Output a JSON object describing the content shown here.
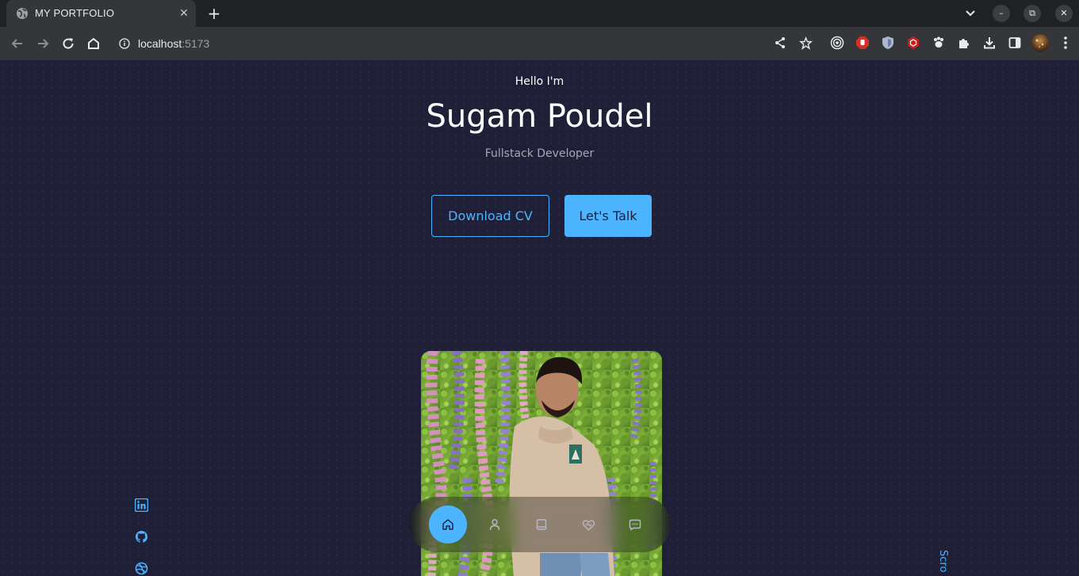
{
  "browser": {
    "tab_title": "MY PORTFOLIO",
    "tab_close": "✕",
    "new_tab": "+",
    "url_host": "localhost",
    "url_port": ":5173",
    "window_controls": {
      "minimize": "–",
      "restore": "⧉",
      "close": "✕"
    }
  },
  "header": {
    "greeting": "Hello I'm",
    "name": "Sugam Poudel",
    "role": "Fullstack Developer",
    "download_cv": "Download CV",
    "lets_talk": "Let's Talk"
  },
  "socials": [
    "linkedin-icon",
    "github-icon",
    "dribbble-icon"
  ],
  "scroll_label": "Scro",
  "nav": {
    "items": [
      "home-icon",
      "user-icon",
      "book-icon",
      "services-icon",
      "message-icon"
    ],
    "active_index": 0
  },
  "colors": {
    "accent": "#4db5ff",
    "background": "#1f1f38",
    "text": "#ffffff"
  }
}
